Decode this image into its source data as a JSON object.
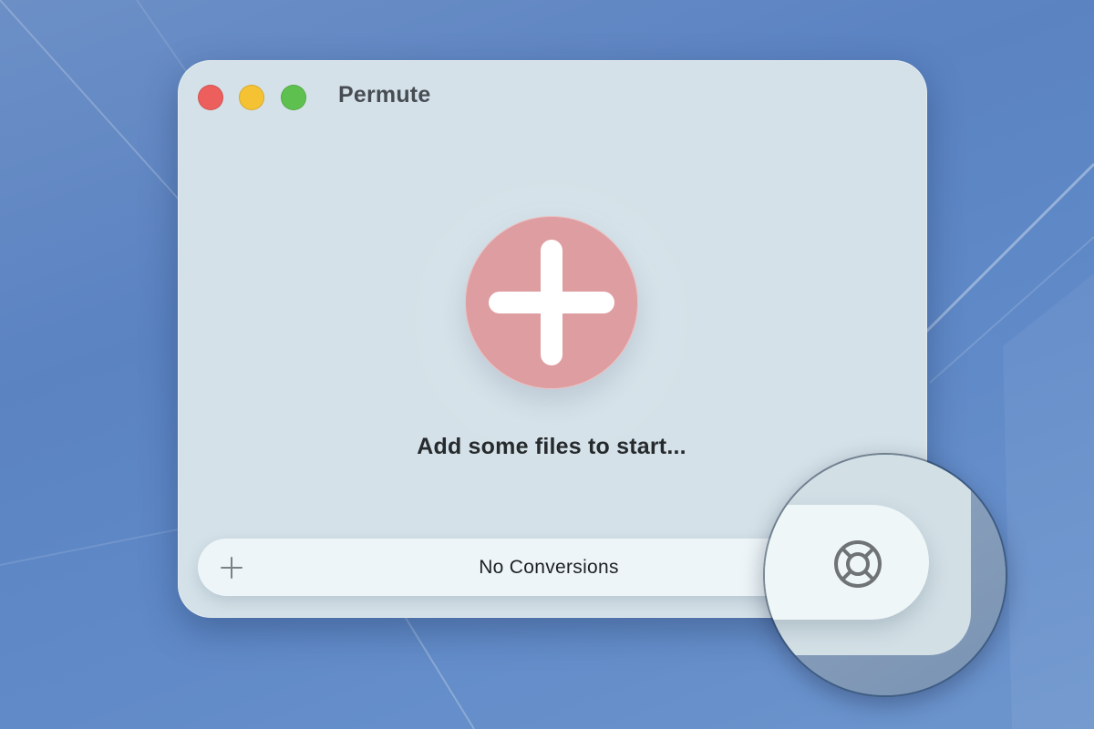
{
  "window": {
    "title": "Permute"
  },
  "titlebar": {
    "controls": [
      {
        "name": "close",
        "color": "#ec5f5d"
      },
      {
        "name": "minimize",
        "color": "#f4c232"
      },
      {
        "name": "maximize",
        "color": "#5ec14f"
      }
    ]
  },
  "main": {
    "add_icon": "plus-icon",
    "add_button_color": "#de9da0",
    "hint": "Add some files to start..."
  },
  "bottombar": {
    "add_icon": "plus-icon",
    "status": "No Conversions",
    "help_icon": "lifebuoy-icon"
  }
}
